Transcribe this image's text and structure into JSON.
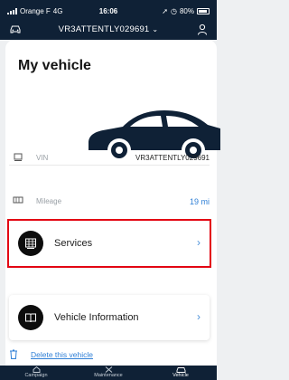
{
  "status_bar": {
    "carrier": "Orange F",
    "network": "4G",
    "time": "16:06",
    "battery": "80%"
  },
  "header": {
    "vin_selector": "VR3ATTENTLY029691",
    "chevron": "⌄"
  },
  "page": {
    "title": "My vehicle"
  },
  "vehicle_details": {
    "vin_label": "VIN",
    "vin_value": "VR3ATTENTLY029691",
    "mileage_label": "Mileage",
    "mileage_value": "19 mi"
  },
  "menu": [
    {
      "label": "Services",
      "icon": "services-icon",
      "arrow": "›"
    },
    {
      "label": "Vehicle Information",
      "icon": "book-icon",
      "arrow": "›"
    }
  ],
  "delete_link": "Delete this vehicle",
  "tabs": [
    {
      "label": "Campaign",
      "icon": "home-icon"
    },
    {
      "label": "Maintenance",
      "icon": "tools-icon"
    },
    {
      "label": "Vehicle",
      "icon": "car-icon"
    }
  ],
  "colors": {
    "header_bg": "#0f2136",
    "accent_blue": "#2f7fd6",
    "highlight_red": "#e30613"
  }
}
